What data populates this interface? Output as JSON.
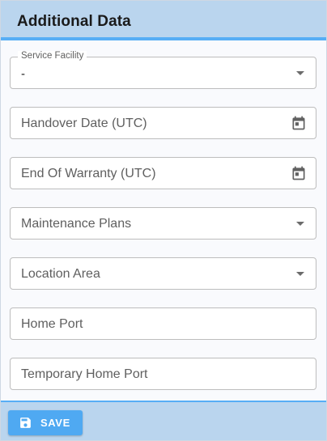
{
  "header": {
    "title": "Additional Data"
  },
  "fields": {
    "service_facility": {
      "label": "Service Facility",
      "value": "-",
      "icon": "chevron-down-icon"
    },
    "handover_date": {
      "label": "Handover Date (UTC)",
      "icon": "calendar-icon"
    },
    "end_of_warranty": {
      "label": "End Of Warranty (UTC)",
      "icon": "calendar-icon"
    },
    "maintenance_plans": {
      "label": "Maintenance Plans",
      "icon": "chevron-down-icon"
    },
    "location_area": {
      "label": "Location Area",
      "icon": "chevron-down-icon"
    },
    "home_port": {
      "label": "Home Port"
    },
    "temporary_home_port": {
      "label": "Temporary Home Port"
    }
  },
  "footer": {
    "save_label": "SAVE",
    "save_icon": "floppy-disk-icon"
  },
  "colors": {
    "header_bg": "#bad5ee",
    "accent": "#57aef5",
    "button_bg": "#4fa9f2",
    "field_border": "#bdbdbd",
    "panel_bg": "#f9fafd"
  }
}
